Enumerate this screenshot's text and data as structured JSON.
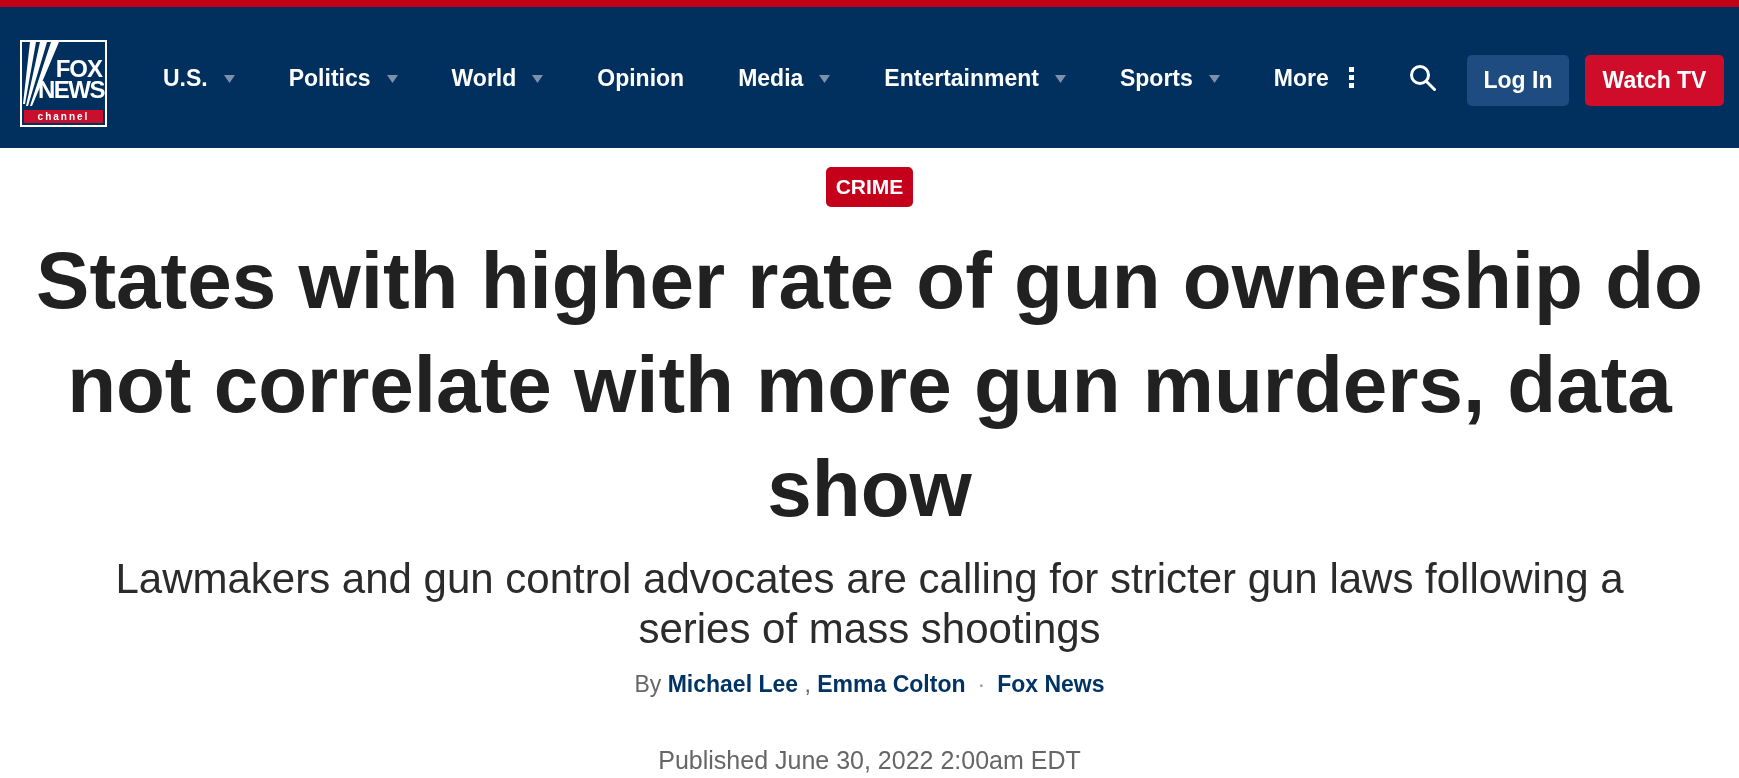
{
  "header": {
    "logo": {
      "line_1": "FOX",
      "line_2": "NEWS",
      "band": "channel"
    },
    "nav": [
      {
        "label": "U.S.",
        "kind": "dropdown"
      },
      {
        "label": "Politics",
        "kind": "dropdown"
      },
      {
        "label": "World",
        "kind": "dropdown"
      },
      {
        "label": "Opinion",
        "kind": "link"
      },
      {
        "label": "Media",
        "kind": "dropdown"
      },
      {
        "label": "Entertainment",
        "kind": "dropdown"
      },
      {
        "label": "Sports",
        "kind": "dropdown"
      },
      {
        "label": "More",
        "kind": "more"
      }
    ],
    "buttons": [
      {
        "label": "Log In",
        "kind": "login"
      },
      {
        "label": "Watch TV",
        "kind": "watch"
      }
    ]
  },
  "article": {
    "category": "CRIME",
    "headline": "States with higher rate of gun ownership do not correlate with more gun murders, data show",
    "subheadline": "Lawmakers and gun control advocates are calling for stricter gun laws following a series of mass shootings",
    "byline": {
      "prefix": "By",
      "authors": [
        "Michael Lee",
        "Emma Colton"
      ],
      "author_separator": ",",
      "source_separator": "·",
      "source": "Fox News"
    },
    "published": "Published June 30, 2022 2:00am EDT"
  }
}
